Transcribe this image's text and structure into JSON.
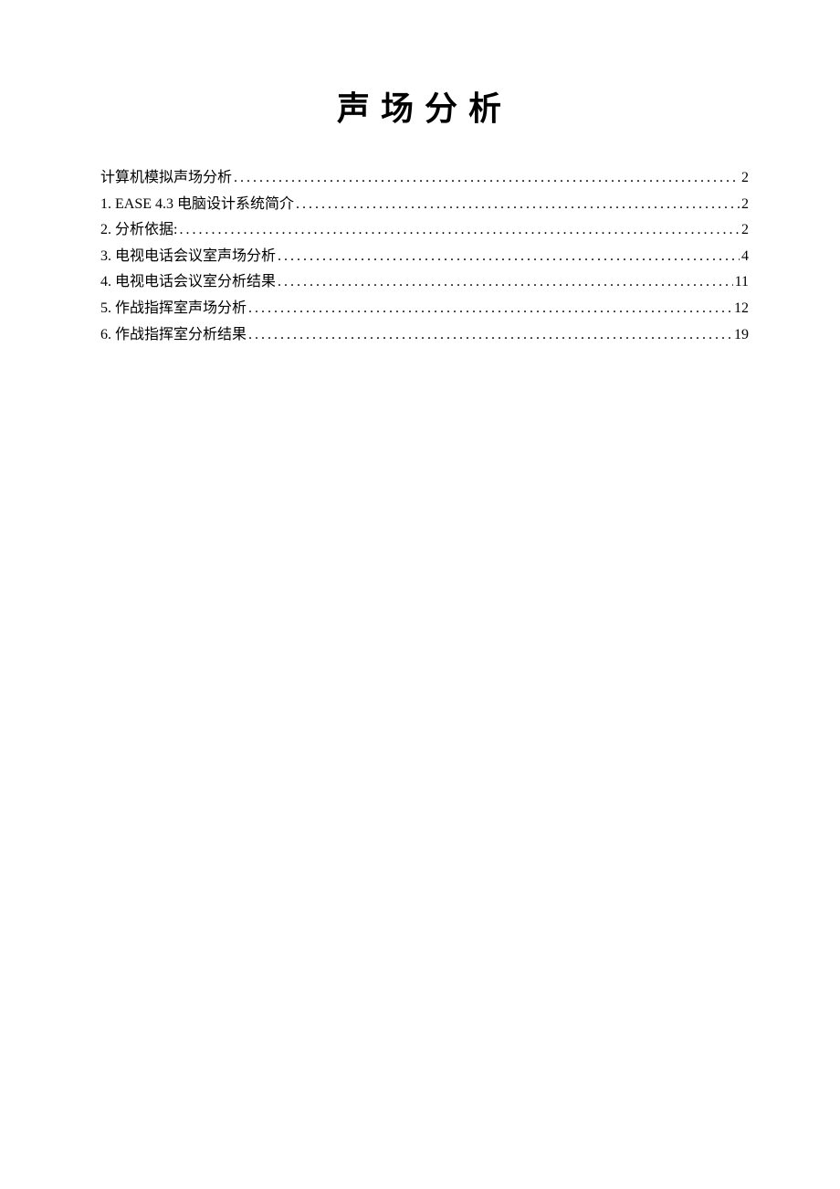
{
  "title": "声场分析",
  "toc": {
    "entries": [
      {
        "label": "计算机模拟声场分析",
        "page": "2"
      },
      {
        "label": "1. EASE 4.3 电脑设计系统简介",
        "page": "2"
      },
      {
        "label": "2. 分析依据:",
        "page": "2"
      },
      {
        "label": "3. 电视电话会议室声场分析",
        "page": "4"
      },
      {
        "label": "4. 电视电话会议室分析结果",
        "page": "11"
      },
      {
        "label": "5. 作战指挥室声场分析",
        "page": "12"
      },
      {
        "label": "6. 作战指挥室分析结果",
        "page": "19"
      }
    ]
  }
}
